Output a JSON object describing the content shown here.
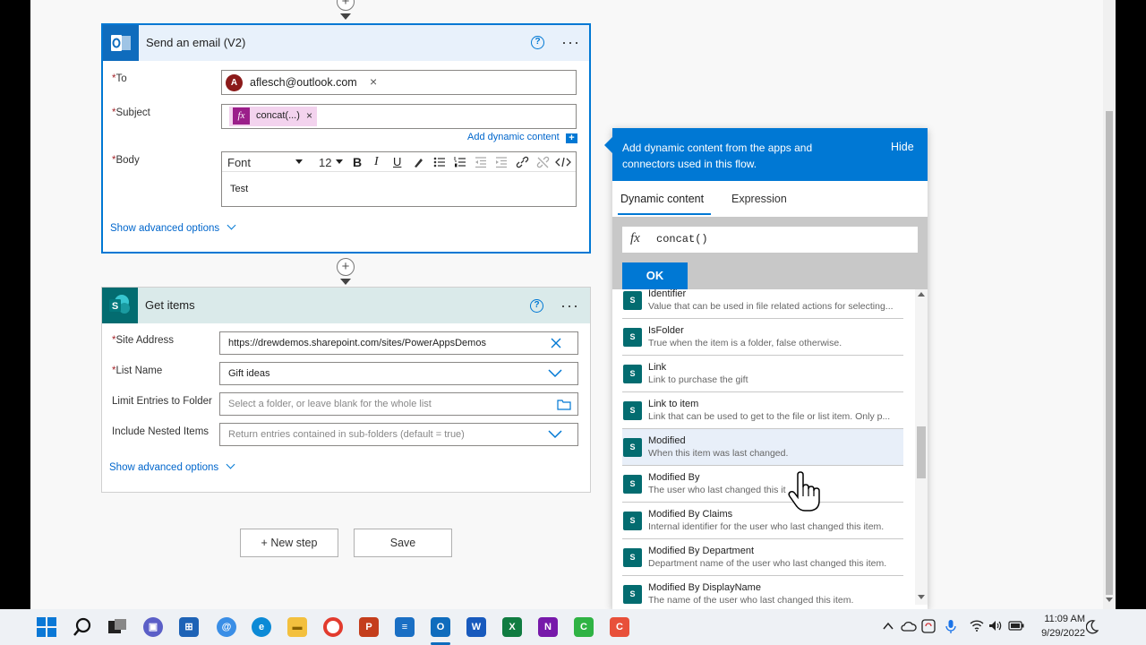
{
  "canvas": {
    "top_connector_label": "+",
    "mid_connector_label": "+"
  },
  "send_email": {
    "title": "Send an email (V2)",
    "help_icon": "?",
    "more_icon": "···",
    "to_label": "To",
    "to_avatar": "A",
    "to_value": "aflesch@outlook.com",
    "to_remove": "×",
    "subject_label": "Subject",
    "subject_token_icon": "fx",
    "subject_token": "concat(...)",
    "subject_token_remove": "×",
    "add_dynamic_content": "Add dynamic content",
    "add_dynamic_plus": "+",
    "body_label": "Body",
    "toolbar": {
      "font": "Font",
      "size": "12",
      "bold": "B",
      "italic": "I",
      "underline": "U"
    },
    "body_text": "Test",
    "show_advanced": "Show advanced options"
  },
  "get_items": {
    "title": "Get items",
    "icon_letter": "S",
    "help_icon": "?",
    "more_icon": "···",
    "site_address_label": "Site Address",
    "site_address_value": "https://drewdemos.sharepoint.com/sites/PowerAppsDemos",
    "list_name_label": "List Name",
    "list_name_value": "Gift ideas",
    "limit_folder_label": "Limit Entries to Folder",
    "limit_folder_placeholder": "Select a folder, or leave blank for the whole list",
    "nested_label": "Include Nested Items",
    "nested_placeholder": "Return entries contained in sub-folders (default = true)",
    "show_advanced": "Show advanced options"
  },
  "buttons": {
    "new_step": "+ New step",
    "save": "Save"
  },
  "dynamic_panel": {
    "header_text": "Add dynamic content from the apps and connectors used in this flow.",
    "hide": "Hide",
    "tab_dynamic": "Dynamic content",
    "tab_expression": "Expression",
    "fx_symbol": "fx",
    "expression_value": "concat()",
    "ok": "OK",
    "items": [
      {
        "name": "Identifier",
        "desc": "Value that can be used in file related actions for selecting..."
      },
      {
        "name": "IsFolder",
        "desc": "True when the item is a folder, false otherwise."
      },
      {
        "name": "Link",
        "desc": "Link to purchase the gift"
      },
      {
        "name": "Link to item",
        "desc": "Link that can be used to get to the file or list item. Only p..."
      },
      {
        "name": "Modified",
        "desc": "When this item was last changed."
      },
      {
        "name": "Modified By",
        "desc": "The user who last changed this it"
      },
      {
        "name": "Modified By Claims",
        "desc": "Internal identifier for the user who last changed this item."
      },
      {
        "name": "Modified By Department",
        "desc": "Department name of the user who last changed this item."
      },
      {
        "name": "Modified By DisplayName",
        "desc": "The name of the user who last changed this item."
      }
    ],
    "highlighted_item": "Modified"
  },
  "taskbar": {
    "time": "11:09 AM",
    "date": "9/29/2022"
  },
  "colors": {
    "accent": "#0078d4",
    "outlook": "#0f6cbd",
    "sharepoint": "#036c70"
  }
}
